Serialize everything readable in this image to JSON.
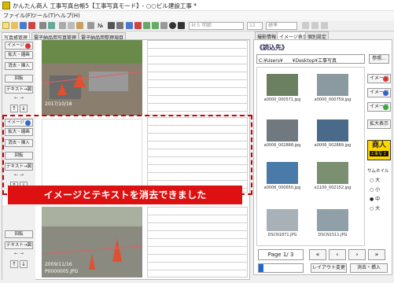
{
  "window": {
    "title": "かんたん商人 工事写真台帳5【工事写真モード】- ○○ビル建設工事 *"
  },
  "menu": [
    "ファイル(F)",
    "ツール(T)",
    "ヘルプ(H)"
  ],
  "toolbar": {
    "font_name": "ＭＳ 明朝",
    "font_size": "12",
    "layout": "標準",
    "no_label": "№"
  },
  "tabs": {
    "left": [
      "写真帳管理",
      "電子納品用写真管理",
      "電子納品用整理項目"
    ],
    "right": [
      "撮影情報",
      "イメージ表示",
      "個別設定"
    ]
  },
  "blocks": [
    {
      "image_btn": "イメージ",
      "expand": "拡大・縮画",
      "erase": "消去・挿入",
      "rotate": "回転",
      "text_to_image": "テキスト→図",
      "photo_date": "2017/10/18",
      "photo_code": ""
    },
    {
      "image_btn": "イメージ",
      "expand": "拡大・縮画",
      "erase": "消去・挿入",
      "rotate": "回転",
      "text_to_image": "テキスト→図",
      "photo_date": "",
      "photo_code": ""
    },
    {
      "image_btn": "イメージ",
      "expand": "",
      "erase": "",
      "rotate": "回転",
      "text_to_image": "テキスト→図",
      "photo_date": "2009/11/16",
      "photo_code": "P0000005.JPG"
    }
  ],
  "banner": "イメージとテキストを消去できました",
  "right": {
    "header": "《読込先》",
    "path": "C:¥Users¥　　¥Desktop¥工事写真",
    "ref_button": "参照...",
    "thumbnails": [
      "a0000_000571.jpg",
      "a0000_000759.jpg",
      "a0006_002888.jpg",
      "a0006_002889.jpg",
      "a0006_000650.jpg",
      "a1100_002152.jpg",
      "DSCN1871.JPG",
      "DSCN1511.JPG"
    ],
    "side_buttons": [
      "イメージ",
      "イメージ",
      "イメージ"
    ],
    "zoom_button": "拡大表示",
    "logo_text": "商人",
    "logo_sub": "工事写",
    "logo_num": "2",
    "size_label": "サムネイル",
    "size_options": [
      "大",
      "小",
      "中",
      "大"
    ],
    "page": "Page 1/ 3",
    "layout_change": "レイアウト変更",
    "erase_insert": "消去・挿入"
  }
}
